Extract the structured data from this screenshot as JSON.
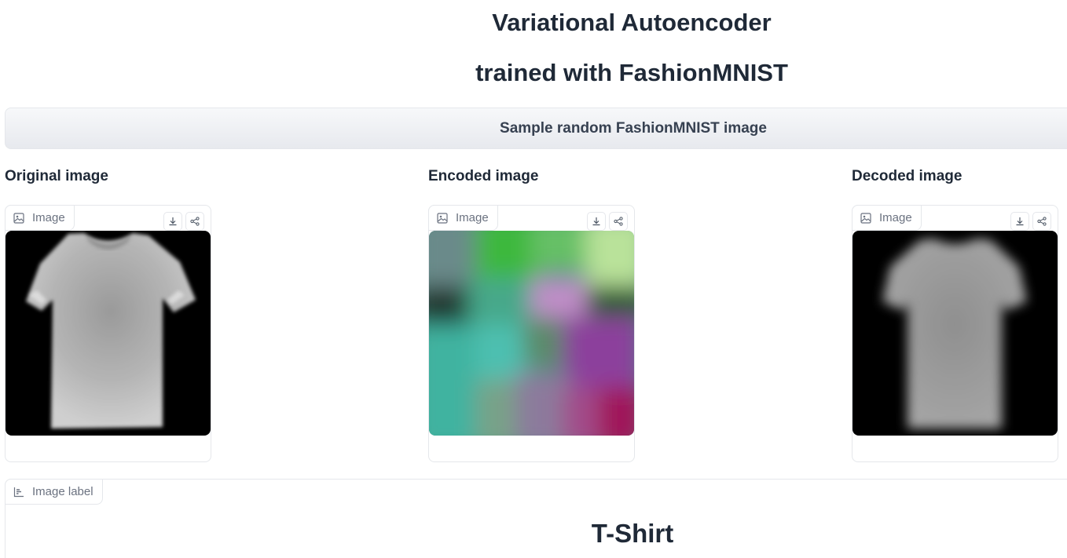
{
  "header": {
    "title_line1": "Variational Autoencoder",
    "title_line2": "trained with FashionMNIST"
  },
  "actions": {
    "sample_button": "Sample random FashionMNIST image"
  },
  "columns": [
    {
      "label": "Original image",
      "tag": "Image",
      "icon": "image-icon"
    },
    {
      "label": "Encoded image",
      "tag": "Image",
      "icon": "image-icon"
    },
    {
      "label": "Decoded image",
      "tag": "Image",
      "icon": "image-icon"
    }
  ],
  "label_panel": {
    "tag": "Image label",
    "tag_icon": "bar-chart-icon",
    "value": "T-Shirt"
  },
  "icons": {
    "download": "download-icon",
    "share": "share-icon"
  }
}
